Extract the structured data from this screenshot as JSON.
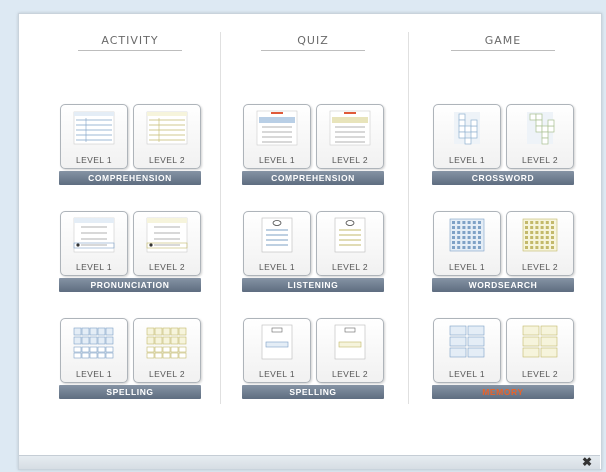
{
  "columns": [
    {
      "title": "ACTIVITY",
      "groups": [
        {
          "label": "COMPREHENSION",
          "highlight": false,
          "levels": [
            "LEVEL 1",
            "LEVEL 2"
          ],
          "thumb": "table"
        },
        {
          "label": "PRONUNCIATION",
          "highlight": false,
          "levels": [
            "LEVEL 1",
            "LEVEL 2"
          ],
          "thumb": "pronounce"
        },
        {
          "label": "SPELLING",
          "highlight": false,
          "levels": [
            "LEVEL 1",
            "LEVEL 2"
          ],
          "thumb": "letters"
        }
      ]
    },
    {
      "title": "QUIZ",
      "groups": [
        {
          "label": "COMPREHENSION",
          "highlight": false,
          "levels": [
            "LEVEL 1",
            "LEVEL 2"
          ],
          "thumb": "quiz"
        },
        {
          "label": "LISTENING",
          "highlight": false,
          "levels": [
            "LEVEL 1",
            "LEVEL 2"
          ],
          "thumb": "listen"
        },
        {
          "label": "SPELLING",
          "highlight": false,
          "levels": [
            "LEVEL 1",
            "LEVEL 2"
          ],
          "thumb": "spell"
        }
      ]
    },
    {
      "title": "GAME",
      "groups": [
        {
          "label": "CROSSWORD",
          "highlight": false,
          "levels": [
            "LEVEL 1",
            "LEVEL 2"
          ],
          "thumb": "crossword"
        },
        {
          "label": "WORDSEARCH",
          "highlight": false,
          "levels": [
            "LEVEL 1",
            "LEVEL 2"
          ],
          "thumb": "wordsearch"
        },
        {
          "label": "MEMORY",
          "highlight": true,
          "levels": [
            "LEVEL 1",
            "LEVEL 2"
          ],
          "thumb": "memory"
        }
      ]
    }
  ],
  "thumb_text": {
    "pronounce_word": "depends on",
    "spell_word": "MANDCCI"
  },
  "close_label": "✖",
  "colors": {
    "bar": "#6b7a8c",
    "highlight_text": "#e8622a",
    "level1_tint": "#e4edf6",
    "level2_tint": "#f6f4dc"
  }
}
